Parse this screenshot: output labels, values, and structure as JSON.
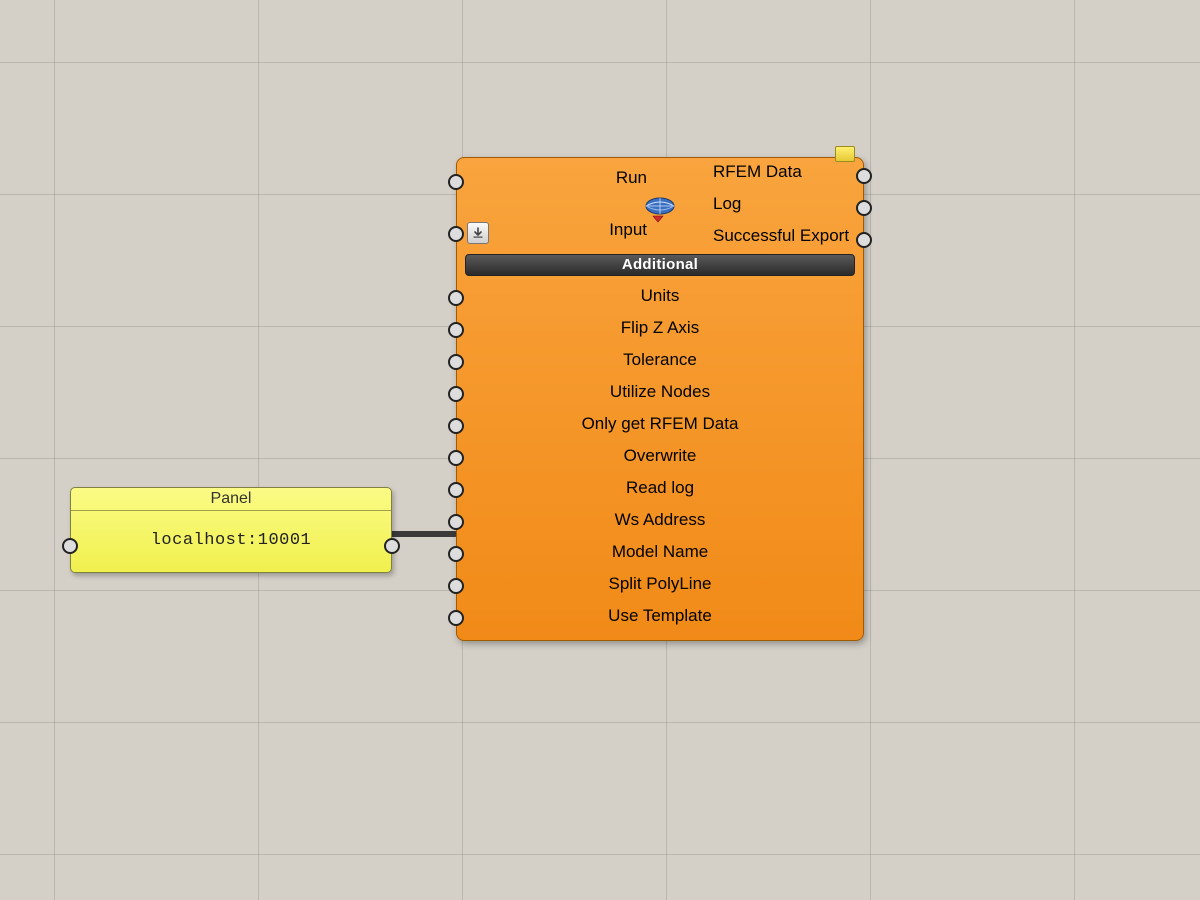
{
  "panel": {
    "title": "Panel",
    "value": "localhost:10001"
  },
  "component": {
    "inputs": [
      "Run",
      "Input"
    ],
    "outputs": [
      "RFEM Data",
      "Log",
      "Successful Export"
    ],
    "section_label": "Additional",
    "additional_inputs": [
      "Units",
      "Flip Z Axis",
      "Tolerance",
      "Utilize Nodes",
      "Only get RFEM Data",
      "Overwrite",
      "Read log",
      "Ws Address",
      "Model Name",
      "Split PolyLine",
      "Use Template"
    ]
  }
}
